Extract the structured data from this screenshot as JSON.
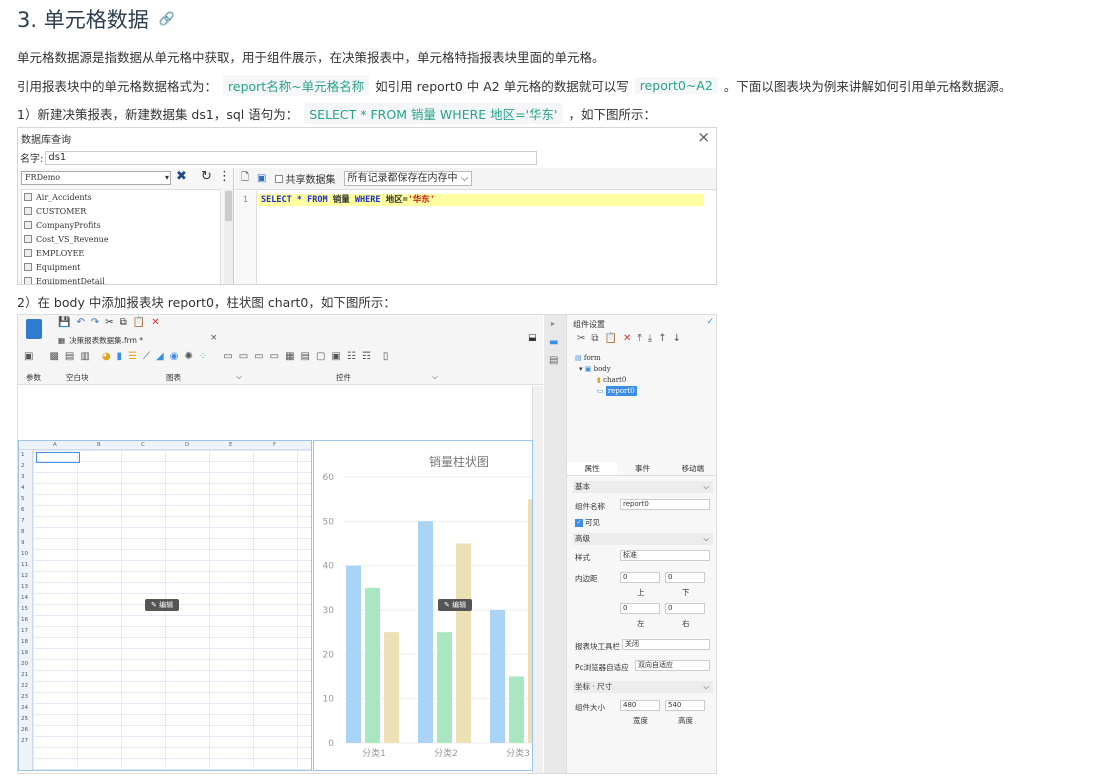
{
  "heading": {
    "text": "3. 单元格数据",
    "anchor_icon": "link-icon"
  },
  "para1": "单元格数据源是指数据从单元格中获取，用于组件展示，在决策报表中，单元格特指报表块里面的单元格。",
  "para2": {
    "before": "引用报表块中的单元格数据格式为：",
    "code1": "report名称~单元格名称",
    "middle": "如引用 report0 中 A2 单元格的数据就可以写",
    "code2": "report0~A2",
    "after": "。下面以图表块为例来讲解如何引用单元格数据源。"
  },
  "step1": {
    "before": "1）新建决策报表，新建数据集 ds1，sql 语句为：",
    "code": "SELECT * FROM 销量 WHERE 地区='华东'",
    "after": "，如下图所示："
  },
  "step2": "2）在 body 中添加报表块 report0，柱状图 chart0，如下图所示：",
  "dialog": {
    "title": "数据库查询",
    "name_label": "名字:",
    "name_value": "ds1",
    "connection": "FRDemo",
    "tables": [
      "Air_Accidents",
      "CUSTOMER",
      "CompanyProfits",
      "Cost_VS_Revenue",
      "EMPLOYEE",
      "Equipment",
      "EquipmentDetail"
    ],
    "share_label": "共享数据集",
    "memory_option": "所有记录都保存在内存中",
    "line_number": "1",
    "sql": {
      "kw1": "SELECT",
      "star": "*",
      "kw2": "FROM",
      "table": "销量",
      "kw3": "WHERE",
      "cond": "地区=",
      "str": "'华东'"
    }
  },
  "designer": {
    "tab_label": "决策报表数据集.frm *",
    "ribbon_labels": {
      "params": "参数",
      "blank": "空白块",
      "chart": "图表",
      "widget": "控件"
    },
    "columns": [
      "A",
      "B",
      "C",
      "D",
      "E",
      "F"
    ],
    "rows": [
      "1",
      "2",
      "3",
      "4",
      "5",
      "6",
      "7",
      "8",
      "9",
      "10",
      "11",
      "12",
      "13",
      "14",
      "15",
      "16",
      "17",
      "18",
      "19",
      "20",
      "21",
      "22",
      "23",
      "24",
      "25",
      "26",
      "27"
    ],
    "edit_label": "编辑",
    "panel": {
      "title": "组件设置",
      "tree": {
        "root": "form",
        "body": "body",
        "chart": "chart0",
        "report": "report0"
      },
      "tabs": [
        "属性",
        "事件",
        "移动端"
      ],
      "basic": "基本",
      "comp_name_label": "组件名称",
      "comp_name_value": "report0",
      "visible_label": "可见",
      "advanced": "高级",
      "style_label": "样式",
      "style_value": "标准",
      "padding_label": "内边距",
      "pad_values": [
        "0",
        "0",
        "0",
        "0"
      ],
      "pad_labels": [
        "上",
        "下",
        "左",
        "右"
      ],
      "toolbar_label": "报表块工具栏",
      "toolbar_value": "关闭",
      "pc_label": "Pc浏览器自适应",
      "pc_value": "双向自适应",
      "coord_label": "坐标 · 尺寸",
      "size_label": "组件大小",
      "width_value": "480",
      "height_value": "540",
      "width_label": "宽度",
      "height_label": "高度"
    }
  },
  "chart_data": {
    "type": "bar",
    "title": "销量柱状图",
    "categories": [
      "分类1",
      "分类2",
      "分类3"
    ],
    "series": [
      {
        "values": [
          40,
          50,
          30
        ],
        "color": "#a9d4f5"
      },
      {
        "values": [
          35,
          25,
          15
        ],
        "color": "#a9e6c2"
      },
      {
        "values": [
          25,
          45,
          55
        ],
        "color": "#eee0b5"
      }
    ],
    "ylim": [
      0,
      60
    ],
    "yticks": [
      0,
      10,
      20,
      30,
      40,
      50,
      60
    ]
  }
}
